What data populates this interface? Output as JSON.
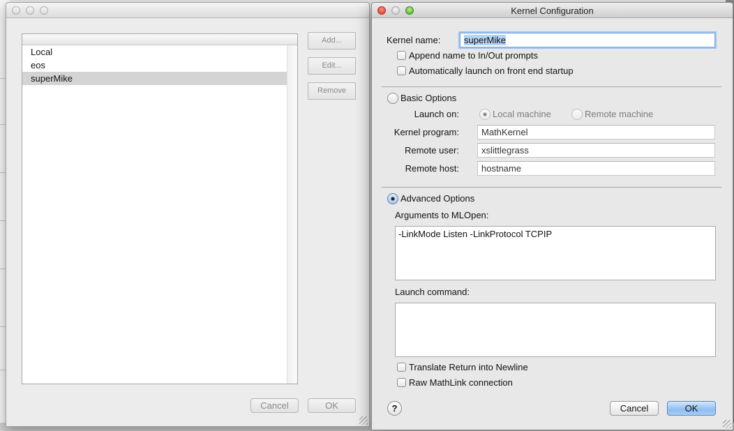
{
  "config_list_window": {
    "list_items": [
      {
        "label": "Local",
        "selected": false
      },
      {
        "label": "eos",
        "selected": false
      },
      {
        "label": "superMike",
        "selected": true
      }
    ],
    "buttons": {
      "add": "Add...",
      "edit": "Edit...",
      "remove": "Remove",
      "cancel": "Cancel",
      "ok": "OK"
    }
  },
  "kernel_config_window": {
    "title": "Kernel Configuration",
    "kernel_name_label": "Kernel name:",
    "kernel_name_value": "superMike",
    "append_name_label": "Append name to In/Out prompts",
    "append_name_checked": false,
    "auto_launch_label": "Automatically launch on front end startup",
    "auto_launch_checked": false,
    "basic_options": {
      "label": "Basic Options",
      "selected": false,
      "launch_on_label": "Launch on:",
      "local_machine_label": "Local machine",
      "local_machine_selected": true,
      "remote_machine_label": "Remote machine",
      "remote_machine_selected": false,
      "kernel_program_label": "Kernel program:",
      "kernel_program_value": "MathKernel",
      "remote_user_label": "Remote user:",
      "remote_user_value": "xslittlegrass",
      "remote_host_label": "Remote host:",
      "remote_host_value": "hostname"
    },
    "advanced_options": {
      "label": "Advanced Options",
      "selected": true,
      "arguments_label": "Arguments to MLOpen:",
      "arguments_value": "-LinkMode Listen -LinkProtocol TCPIP",
      "launch_command_label": "Launch command:",
      "launch_command_value": "",
      "translate_return_label": "Translate Return into Newline",
      "translate_return_checked": false,
      "raw_mathlink_label": "Raw MathLink connection",
      "raw_mathlink_checked": false
    },
    "help_glyph": "?",
    "cancel_label": "Cancel",
    "ok_label": "OK"
  }
}
